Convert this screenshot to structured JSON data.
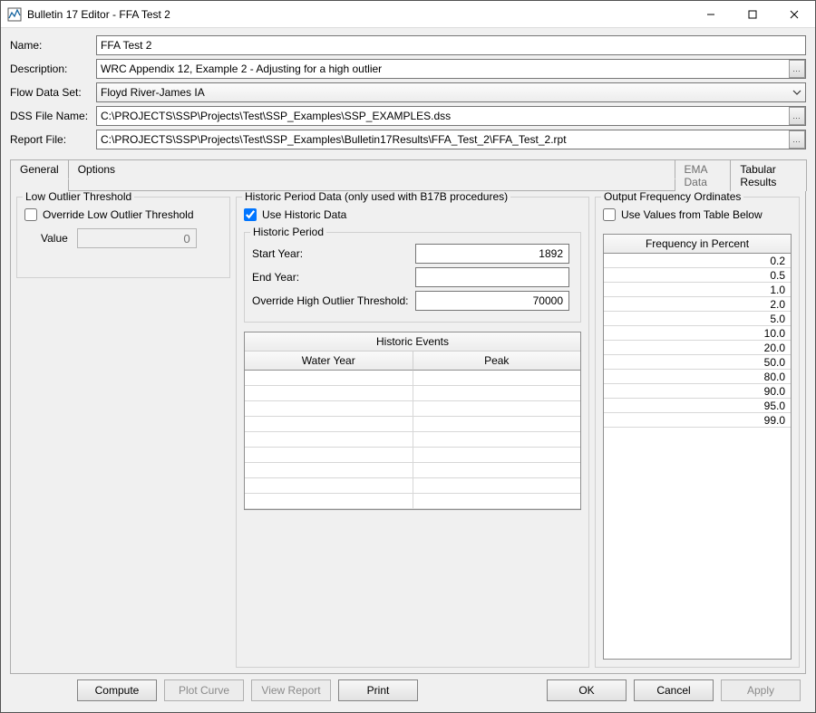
{
  "window": {
    "title": "Bulletin 17 Editor - FFA Test 2"
  },
  "form": {
    "name_label": "Name:",
    "name_value": "FFA Test 2",
    "description_label": "Description:",
    "description_value": "WRC Appendix 12, Example 2 - Adjusting for a high outlier",
    "flowdataset_label": "Flow Data Set:",
    "flowdataset_value": "Floyd River-James IA",
    "dssfile_label": "DSS File Name:",
    "dssfile_value": "C:\\PROJECTS\\SSP\\Projects\\Test\\SSP_Examples\\SSP_EXAMPLES.dss",
    "reportfile_label": "Report File:",
    "reportfile_value": "C:\\PROJECTS\\SSP\\Projects\\Test\\SSP_Examples\\Bulletin17Results\\FFA_Test_2\\FFA_Test_2.rpt"
  },
  "tabs": {
    "general": "General",
    "options": "Options",
    "emadata": "EMA Data",
    "tabular": "Tabular Results"
  },
  "low_outlier": {
    "group_title": "Low Outlier Threshold",
    "override_label": "Override Low Outlier Threshold",
    "value_label": "Value",
    "value_placeholder": "0"
  },
  "historic": {
    "group_title": "Historic Period Data (only used with B17B procedures)",
    "use_historic_label": "Use Historic Data",
    "period_title": "Historic Period",
    "start_year_label": "Start Year:",
    "start_year_value": "1892",
    "end_year_label": "End Year:",
    "end_year_value": "",
    "override_high_label": "Override High Outlier Threshold:",
    "override_high_value": "70000",
    "events_title": "Historic Events",
    "col_water_year": "Water Year",
    "col_peak": "Peak"
  },
  "output_freq": {
    "group_title": "Output Frequency Ordinates",
    "use_table_label": "Use Values from Table Below",
    "table_header": "Frequency in Percent",
    "values": [
      "0.2",
      "0.5",
      "1.0",
      "2.0",
      "5.0",
      "10.0",
      "20.0",
      "50.0",
      "80.0",
      "90.0",
      "95.0",
      "99.0"
    ]
  },
  "buttons": {
    "compute": "Compute",
    "plot_curve": "Plot Curve",
    "view_report": "View Report",
    "print": "Print",
    "ok": "OK",
    "cancel": "Cancel",
    "apply": "Apply"
  }
}
